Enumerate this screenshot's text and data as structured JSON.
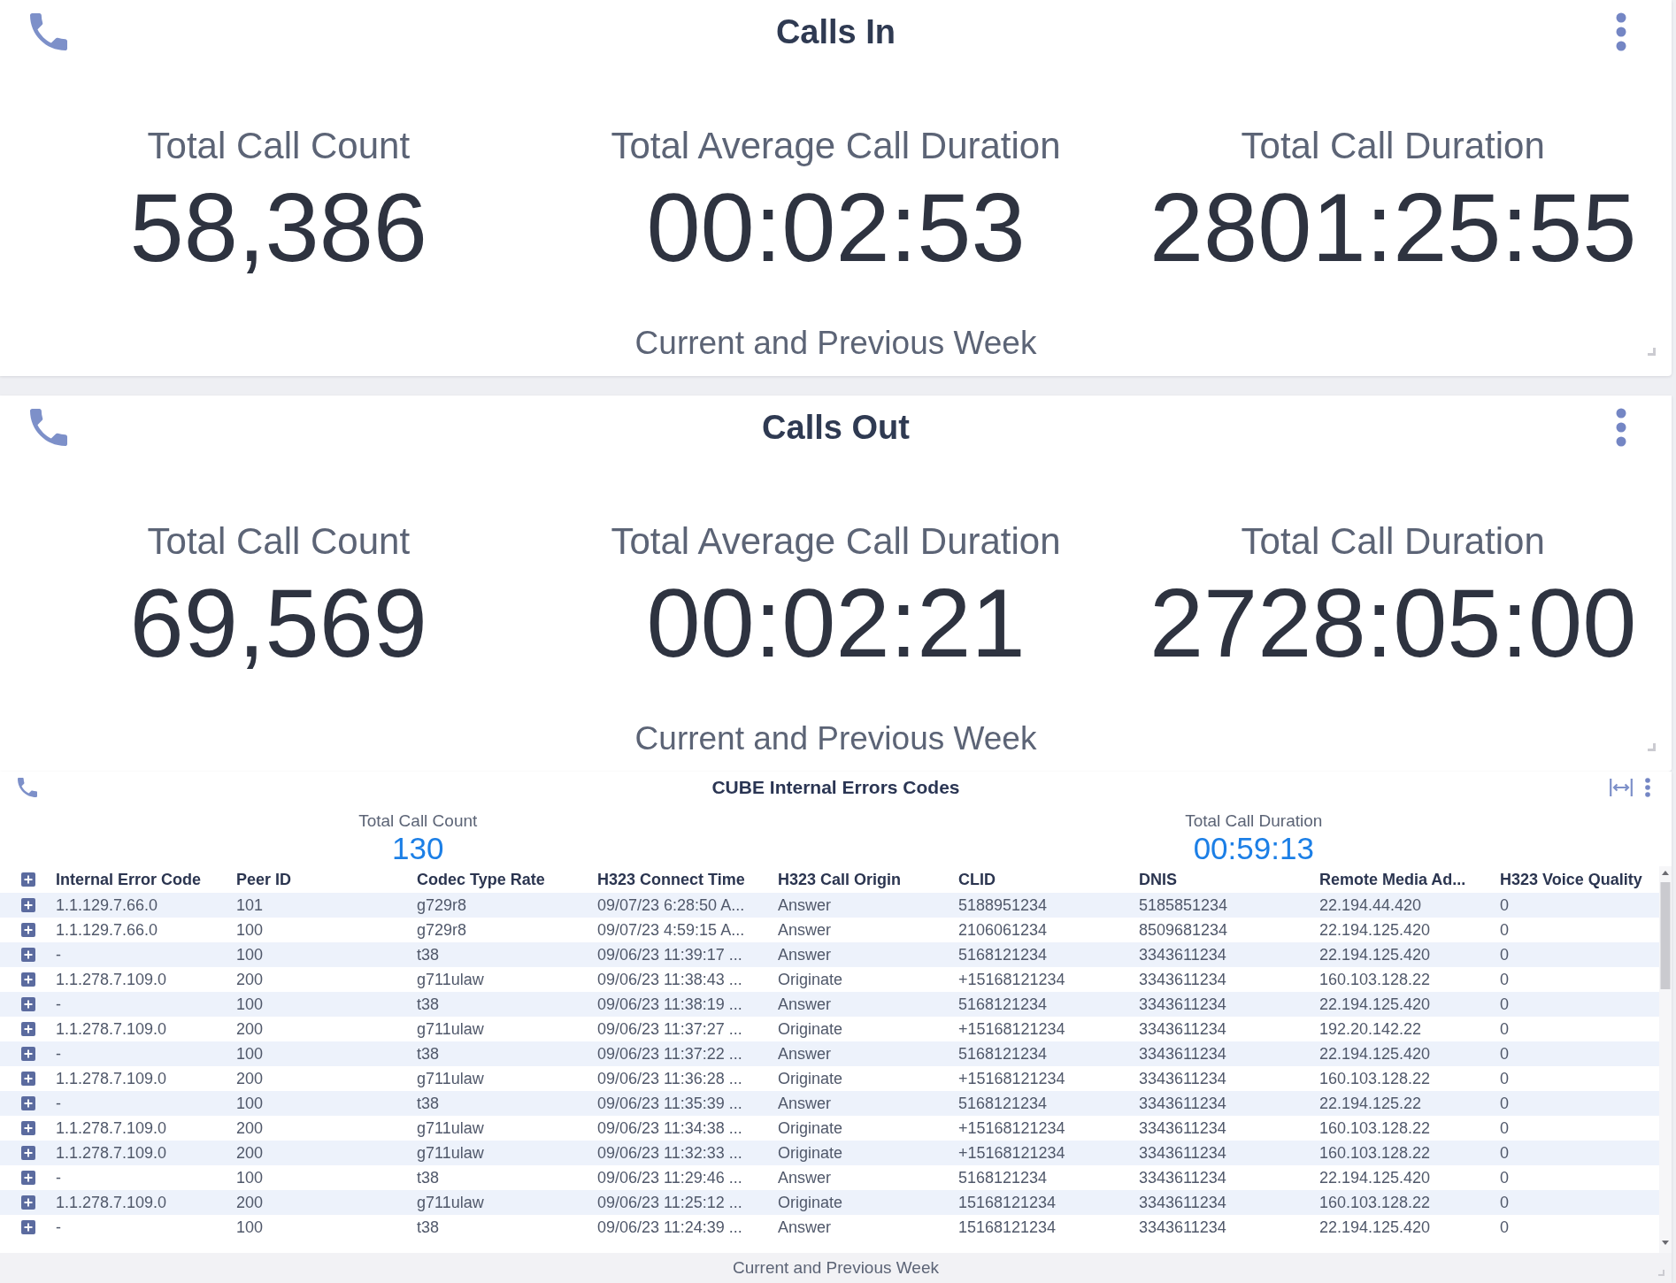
{
  "panels": [
    {
      "kind": "kpi",
      "title": "Calls In",
      "stats": [
        {
          "label": "Total Call Count",
          "value": "58,386"
        },
        {
          "label": "Total Average Call Duration",
          "value": "00:02:53"
        },
        {
          "label": "Total Call Duration",
          "value": "2801:25:55"
        }
      ],
      "footer": "Current and Previous Week"
    },
    {
      "kind": "kpi",
      "title": "Calls Out",
      "stats": [
        {
          "label": "Total Call Count",
          "value": "69,569"
        },
        {
          "label": "Total Average Call Duration",
          "value": "00:02:21"
        },
        {
          "label": "Total Call Duration",
          "value": "2728:05:00"
        }
      ],
      "footer": "Current and Previous Week"
    },
    {
      "kind": "table",
      "title": "CUBE Internal Errors Codes",
      "stats": [
        {
          "label": "Total Call Count",
          "value": "130"
        },
        {
          "label": "Total Call Duration",
          "value": "00:59:13"
        }
      ],
      "table": {
        "columns": [
          "Internal Error Code",
          "Peer ID",
          "Codec Type Rate",
          "H323 Connect Time",
          "H323 Call Origin",
          "CLID",
          "DNIS",
          "Remote Media Ad...",
          "H323 Voice Quality"
        ],
        "rows": [
          {
            "expanded": false,
            "cells": [
              "1.1.129.7.66.0",
              "101",
              "g729r8",
              "09/07/23 6:28:50 A...",
              "Answer",
              "5188951234",
              "5185851234",
              "22.194.44.420",
              "0"
            ]
          },
          {
            "expanded": false,
            "cells": [
              "1.1.129.7.66.0",
              "100",
              "g729r8",
              "09/07/23 4:59:15 A...",
              "Answer",
              "2106061234",
              "8509681234",
              "22.194.125.420",
              "0"
            ]
          },
          {
            "expanded": false,
            "cells": [
              "-",
              "100",
              "t38",
              "09/06/23 11:39:17 ...",
              "Answer",
              "5168121234",
              "3343611234",
              "22.194.125.420",
              "0"
            ]
          },
          {
            "expanded": false,
            "cells": [
              "1.1.278.7.109.0",
              "200",
              "g711ulaw",
              "09/06/23 11:38:43 ...",
              "Originate",
              "+15168121234",
              "3343611234",
              "160.103.128.22",
              "0"
            ]
          },
          {
            "expanded": false,
            "cells": [
              "-",
              "100",
              "t38",
              "09/06/23 11:38:19 ...",
              "Answer",
              "5168121234",
              "3343611234",
              "22.194.125.420",
              "0"
            ]
          },
          {
            "expanded": false,
            "cells": [
              "1.1.278.7.109.0",
              "200",
              "g711ulaw",
              "09/06/23 11:37:27 ...",
              "Originate",
              "+15168121234",
              "3343611234",
              "192.20.142.22",
              "0"
            ]
          },
          {
            "expanded": false,
            "cells": [
              "-",
              "100",
              "t38",
              "09/06/23 11:37:22 ...",
              "Answer",
              "5168121234",
              "3343611234",
              "22.194.125.420",
              "0"
            ]
          },
          {
            "expanded": false,
            "cells": [
              "1.1.278.7.109.0",
              "200",
              "g711ulaw",
              "09/06/23 11:36:28 ...",
              "Originate",
              "+15168121234",
              "3343611234",
              "160.103.128.22",
              "0"
            ]
          },
          {
            "expanded": false,
            "cells": [
              "-",
              "100",
              "t38",
              "09/06/23 11:35:39 ...",
              "Answer",
              "5168121234",
              "3343611234",
              "22.194.125.22",
              "0"
            ]
          },
          {
            "expanded": false,
            "cells": [
              "1.1.278.7.109.0",
              "200",
              "g711ulaw",
              "09/06/23 11:34:38 ...",
              "Originate",
              "+15168121234",
              "3343611234",
              "160.103.128.22",
              "0"
            ]
          },
          {
            "expanded": false,
            "cells": [
              "1.1.278.7.109.0",
              "200",
              "g711ulaw",
              "09/06/23 11:32:33 ...",
              "Originate",
              "+15168121234",
              "3343611234",
              "160.103.128.22",
              "0"
            ]
          },
          {
            "expanded": false,
            "cells": [
              "-",
              "100",
              "t38",
              "09/06/23 11:29:46 ...",
              "Answer",
              "5168121234",
              "3343611234",
              "22.194.125.420",
              "0"
            ]
          },
          {
            "expanded": false,
            "cells": [
              "1.1.278.7.109.0",
              "200",
              "g711ulaw",
              "09/06/23 11:25:12 ...",
              "Originate",
              "15168121234",
              "3343611234",
              "160.103.128.22",
              "0"
            ]
          },
          {
            "expanded": false,
            "cells": [
              "-",
              "100",
              "t38",
              "09/06/23 11:24:39 ...",
              "Answer",
              "15168121234",
              "3343611234",
              "22.194.125.420",
              "0"
            ]
          }
        ]
      },
      "footer": "Current and Previous Week"
    }
  ]
}
